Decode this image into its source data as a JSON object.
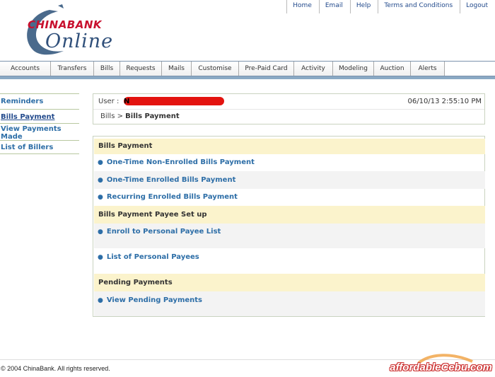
{
  "brand": {
    "logo_word_top": "CHINABANK",
    "logo_word_bottom": "Online",
    "primary_color": "#2d6ea7",
    "logo_red": "#c8102e"
  },
  "toplinks": [
    "Home",
    "Email",
    "Help",
    "Terms and Conditions",
    "Logout"
  ],
  "nav": [
    "Accounts",
    "Transfers",
    "Bills",
    "Requests",
    "Mails",
    "Customise",
    "Pre-Paid Card",
    "Activity",
    "Modeling",
    "Auction",
    "Alerts"
  ],
  "sidebar": {
    "items": [
      {
        "label": "Reminders",
        "active": false
      },
      {
        "label": "Bills Payment",
        "active": true
      },
      {
        "label": "View Payments Made",
        "active": false
      },
      {
        "label": "List of Billers",
        "active": false
      }
    ]
  },
  "userbox": {
    "user_label": "User :",
    "user_initial": "N",
    "datetime": "06/10/13 2:55:10 PM",
    "breadcrumb_parent": "Bills",
    "breadcrumb_separator": ">",
    "breadcrumb_current": "Bills Payment"
  },
  "panel": {
    "section1_title": "Bills Payment",
    "section1_links": [
      "One-Time Non-Enrolled Bills Payment",
      "One-Time Enrolled Bills Payment",
      "Recurring Enrolled Bills Payment"
    ],
    "section2_title": "Bills Payment Payee Set up",
    "section2_links": [
      "Enroll to Personal Payee List",
      "List of Personal Payees"
    ],
    "section3_title": "Pending Payments",
    "section3_links": [
      "View Pending Payments"
    ]
  },
  "footer": {
    "copyright": "© 2004 ChinaBank. All rights reserved.",
    "watermark": "affordableCebu.com"
  }
}
